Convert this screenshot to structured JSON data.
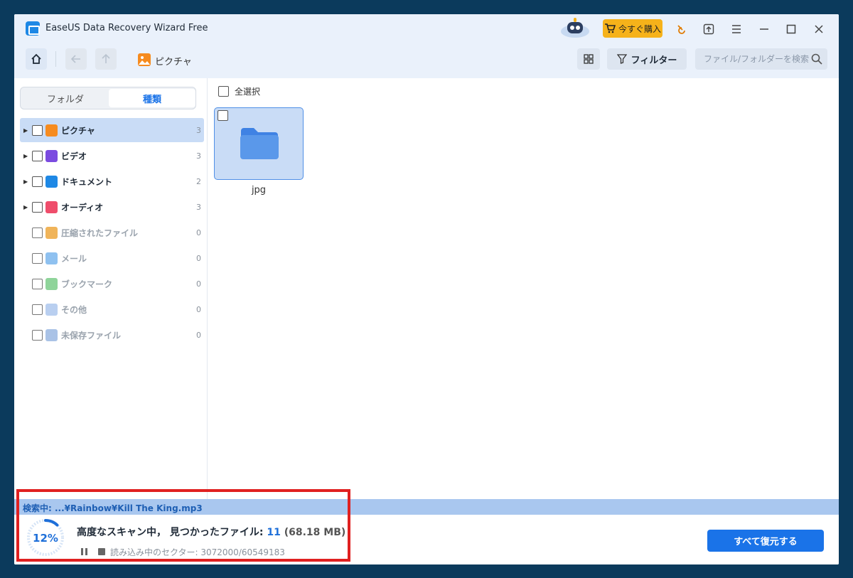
{
  "app": {
    "title": "EaseUS Data Recovery Wizard Free"
  },
  "titlebar": {
    "buy_label": "今すぐ購入"
  },
  "breadcrumb": {
    "label": "ピクチャ"
  },
  "toolbar": {
    "filter_label": "フィルター",
    "search_placeholder": "ファイル/フォルダーを検索"
  },
  "sidebar": {
    "tabs": [
      {
        "label": "フォルダ"
      },
      {
        "label": "種類"
      }
    ],
    "categories": [
      {
        "label": "ピクチャ",
        "count": "3",
        "icon": "picture-icon",
        "color": "#f68b1f"
      },
      {
        "label": "ビデオ",
        "count": "3",
        "icon": "video-icon",
        "color": "#7b4be0"
      },
      {
        "label": "ドキュメント",
        "count": "2",
        "icon": "document-icon",
        "color": "#1e88e5"
      },
      {
        "label": "オーディオ",
        "count": "3",
        "icon": "audio-icon",
        "color": "#ef4d6b"
      },
      {
        "label": "圧縮されたファイル",
        "count": "0",
        "icon": "archive-icon",
        "color": "#f0b45a"
      },
      {
        "label": "メール",
        "count": "0",
        "icon": "mail-icon",
        "color": "#8fc1f0"
      },
      {
        "label": "ブックマーク",
        "count": "0",
        "icon": "bookmark-icon",
        "color": "#8fd49a"
      },
      {
        "label": "その他",
        "count": "0",
        "icon": "other-folder-icon",
        "color": "#b9cff0"
      },
      {
        "label": "未保存ファイル",
        "count": "0",
        "icon": "unsaved-file-icon",
        "color": "#a9c2e6"
      }
    ]
  },
  "content": {
    "select_all": "全選択",
    "files": [
      {
        "name": "jpg"
      }
    ]
  },
  "status": {
    "searching": "検索中: ...¥Rainbow¥Kill The King.mp3",
    "progress_percent": "12%",
    "progress_value": 0.12,
    "scan_prefix": "高度なスキャン中， 見つかったファイル: ",
    "found_count": "11",
    "found_size": "(68.18 MB)",
    "sector_text": "読み込み中のセクター: 3072000/60549183"
  },
  "actions": {
    "recover_all": "すべて復元する"
  },
  "colors": {
    "accent": "#1a73e8",
    "highlight": "#e02020",
    "buy": "#f6b21a"
  }
}
